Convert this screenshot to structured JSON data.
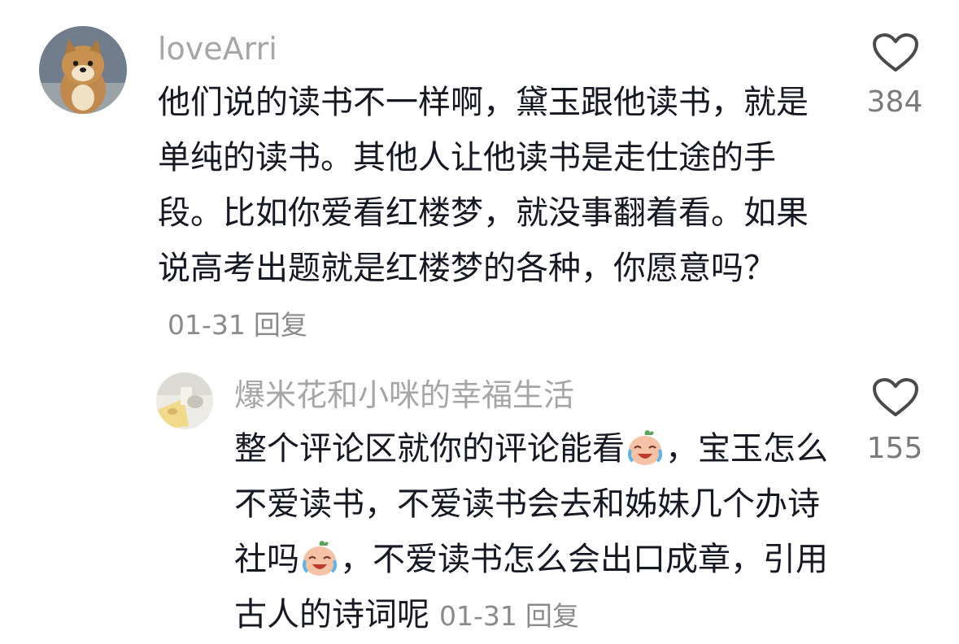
{
  "comments": [
    {
      "username": "loveArri",
      "text_part1": "他们说的读书不一样啊，黛玉跟他读书，就是单纯的读书。其他人让他读书是走仕途的手段。比如你爱看红楼梦，就没事翻着看。如果说高考出题就是红楼梦的各种，你愿意吗？",
      "date": "01-31",
      "reply_label": "回复",
      "like_count": "384",
      "avatar_icon": "shiba-dog-avatar",
      "like_icon": "heart-outline-icon"
    },
    {
      "username": "爆米花和小咪的幸福生活",
      "text_part1": "整个评论区就你的评论能看",
      "text_part2": "，宝玉怎么不爱读书，不爱读书会去和姊妹几个办诗社吗",
      "text_part3": "，不爱读书怎么会出口成章，引用古人的诗词呢",
      "date": "01-31",
      "reply_label": "回复",
      "like_count": "155",
      "avatar_icon": "cat-photo-avatar",
      "emoji_icon": "crying-laughing-emoji",
      "like_icon": "heart-outline-icon"
    }
  ],
  "colors": {
    "username": "#a6a6a6",
    "text": "#161823",
    "meta": "#8a8a8a",
    "like_count": "#7a7a7a",
    "background": "#ffffff"
  }
}
